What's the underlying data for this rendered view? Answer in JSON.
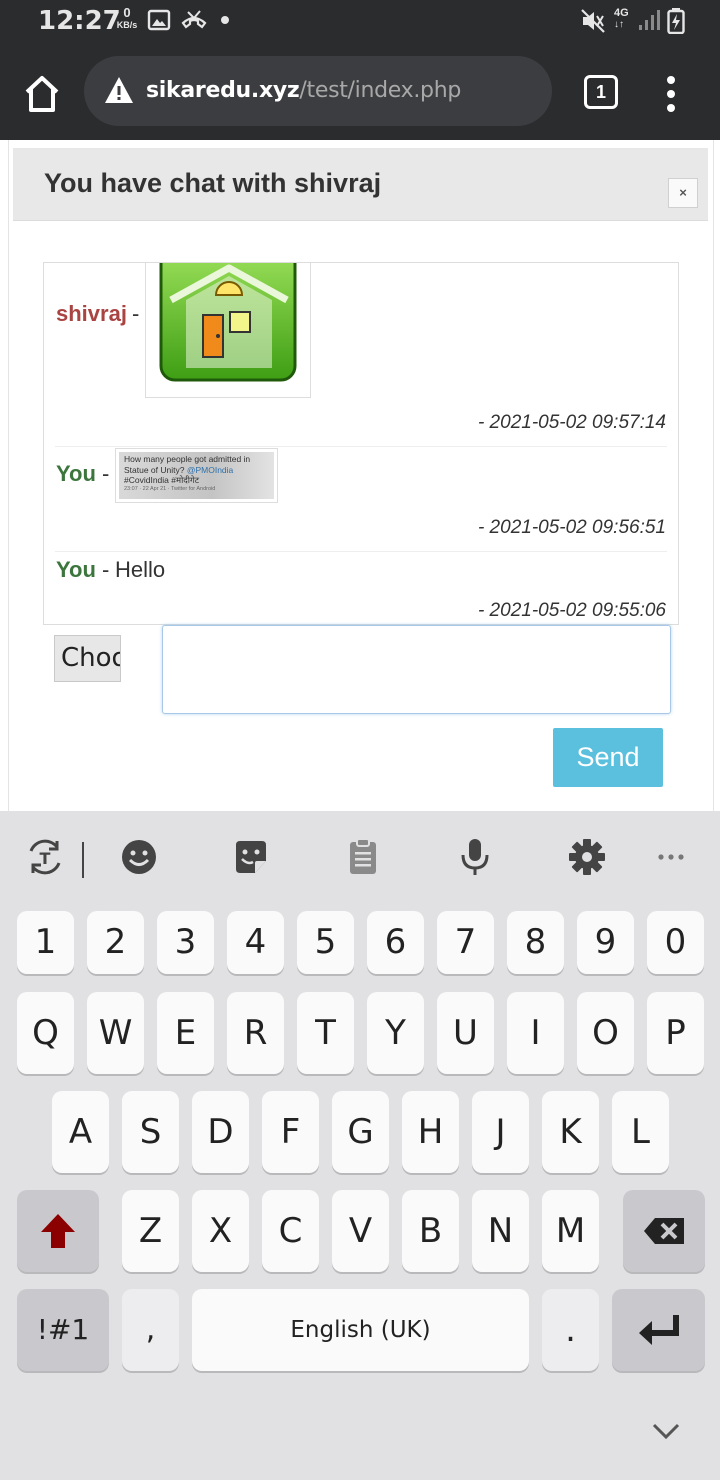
{
  "status_bar": {
    "time": "12:27",
    "net_speed_value": "0",
    "net_speed_unit": "KB/s",
    "network_type": "4G",
    "icons": [
      "image-icon",
      "missed-call-icon",
      "dot-icon",
      "mute-icon",
      "signal-icon",
      "battery-charging-icon"
    ]
  },
  "browser": {
    "url_domain": "sikaredu.xyz",
    "url_path": "/test/index.php",
    "tab_count": "1",
    "icons": [
      "home-icon",
      "warning-icon",
      "tabs-icon",
      "more-vert-icon"
    ]
  },
  "modal": {
    "title": "You have chat with shivraj",
    "close_label": "×"
  },
  "chat": {
    "messages": [
      {
        "sender": "shivraj",
        "separator": "-",
        "type": "image",
        "image": "house-icon-image",
        "timestamp": "- 2021-05-02 09:57:14"
      },
      {
        "sender": "You",
        "separator": "-",
        "type": "image",
        "image": "tweet-screenshot-image",
        "timestamp": "- 2021-05-02 09:56:51"
      },
      {
        "sender": "You",
        "separator": "-",
        "type": "text",
        "text": "Hello",
        "timestamp": "- 2021-05-02 09:55:06"
      }
    ],
    "tweet_image": {
      "line1": "How many people got admitted in",
      "line2a": "Statue of Unity? ",
      "line2b": "@PMOIndia",
      "line3": "#CovidIndia #मोदीगेट",
      "meta": "23:07 · 22 Apr 21 · Twitter for Android"
    }
  },
  "composer": {
    "file_button_label": "Choose File",
    "input_value": "",
    "send_label": "Send"
  },
  "keyboard": {
    "tools": [
      "text-translate-icon",
      "emoji-icon",
      "sticker-icon",
      "clipboard-icon",
      "microphone-icon",
      "settings-icon",
      "more-horiz-icon"
    ],
    "number_row": [
      "1",
      "2",
      "3",
      "4",
      "5",
      "6",
      "7",
      "8",
      "9",
      "0"
    ],
    "row1": [
      "Q",
      "W",
      "E",
      "R",
      "T",
      "Y",
      "U",
      "I",
      "O",
      "P"
    ],
    "row2": [
      "A",
      "S",
      "D",
      "F",
      "G",
      "H",
      "J",
      "K",
      "L"
    ],
    "row3": [
      "Z",
      "X",
      "C",
      "V",
      "B",
      "N",
      "M"
    ],
    "symbols_label": "!#1",
    "comma_label": ",",
    "space_label": "English (UK)",
    "period_label": ".",
    "accent_color": "#8b0000"
  }
}
